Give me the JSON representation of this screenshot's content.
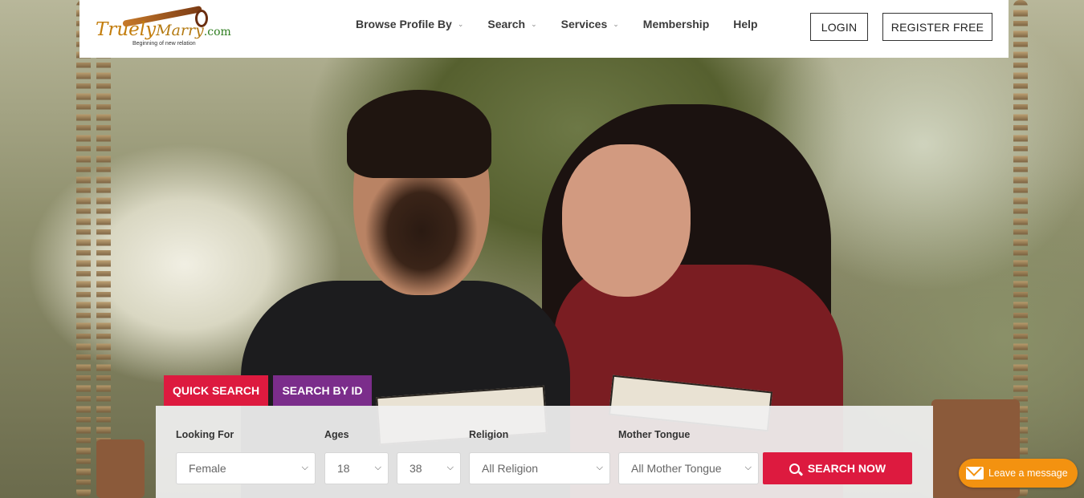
{
  "brand": {
    "logo_name_a": "Truely",
    "logo_name_b": "Marry",
    "logo_domain": ".com",
    "tagline": "Beginning of new relation"
  },
  "nav": {
    "items": [
      {
        "label": "Browse Profile By",
        "dropdown": true
      },
      {
        "label": "Search",
        "dropdown": true
      },
      {
        "label": "Services",
        "dropdown": true
      },
      {
        "label": "Membership",
        "dropdown": false
      },
      {
        "label": "Help",
        "dropdown": false
      }
    ],
    "login_label": "LOGIN",
    "register_label": "REGISTER FREE"
  },
  "search": {
    "tabs": [
      {
        "label": "QUICK SEARCH",
        "active": true
      },
      {
        "label": "SEARCH BY ID",
        "active": false
      }
    ],
    "looking_for_label": "Looking For",
    "looking_for_value": "Female",
    "ages_label": "Ages",
    "age_min": "18",
    "age_max": "38",
    "religion_label": "Religion",
    "religion_value": "All Religion",
    "mother_tongue_label": "Mother Tongue",
    "mother_tongue_value": "All Mother Tongue",
    "submit_label": "SEARCH NOW"
  },
  "chat": {
    "label": "Leave a message"
  },
  "colors": {
    "accent_red": "#dd1a3f",
    "accent_purple": "#7b2d8b",
    "chat_orange": "#f39210"
  }
}
